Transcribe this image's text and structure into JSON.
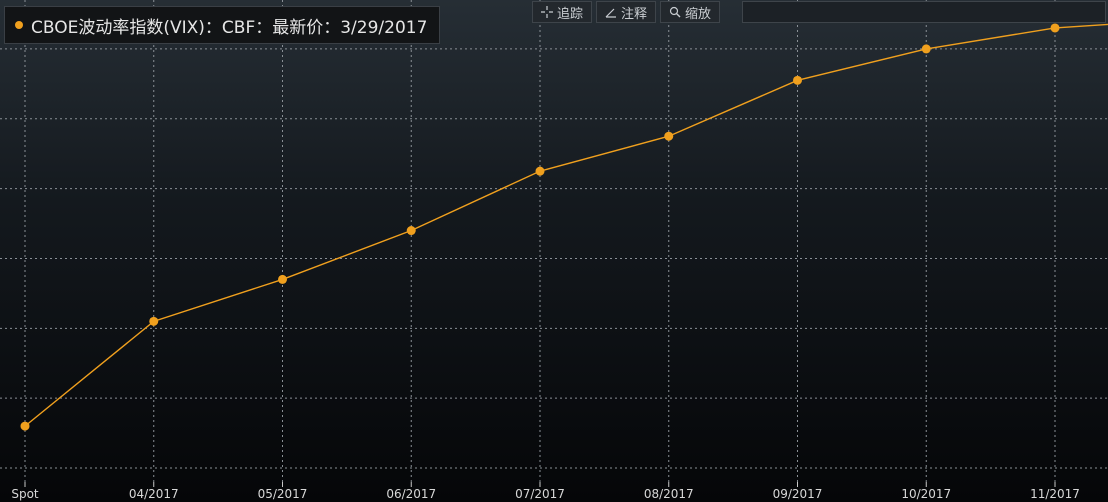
{
  "legend": {
    "text": "CBOE波动率指数(VIX)：CBF：最新价：3/29/2017",
    "color": "#f0a01e"
  },
  "toolbar": {
    "items": [
      {
        "label": "追踪",
        "icon": "crosshair-icon"
      },
      {
        "label": "注释",
        "icon": "pencil-icon"
      },
      {
        "label": "缩放",
        "icon": "magnifier-icon"
      }
    ]
  },
  "chart_data": {
    "type": "line",
    "categories": [
      "Spot",
      "04/2017",
      "05/2017",
      "06/2017",
      "07/2017",
      "08/2017",
      "09/2017",
      "10/2017",
      "11/2017"
    ],
    "values": [
      11.6,
      13.1,
      13.7,
      14.4,
      15.25,
      15.75,
      16.55,
      17.0,
      17.3
    ],
    "trailing_value": 17.35,
    "ylim": [
      10.8,
      17.7
    ],
    "grid": true,
    "line_color": "#f0a01e",
    "gridline_values": [
      11.0,
      12.0,
      13.0,
      14.0,
      15.0,
      16.0,
      17.0
    ]
  }
}
